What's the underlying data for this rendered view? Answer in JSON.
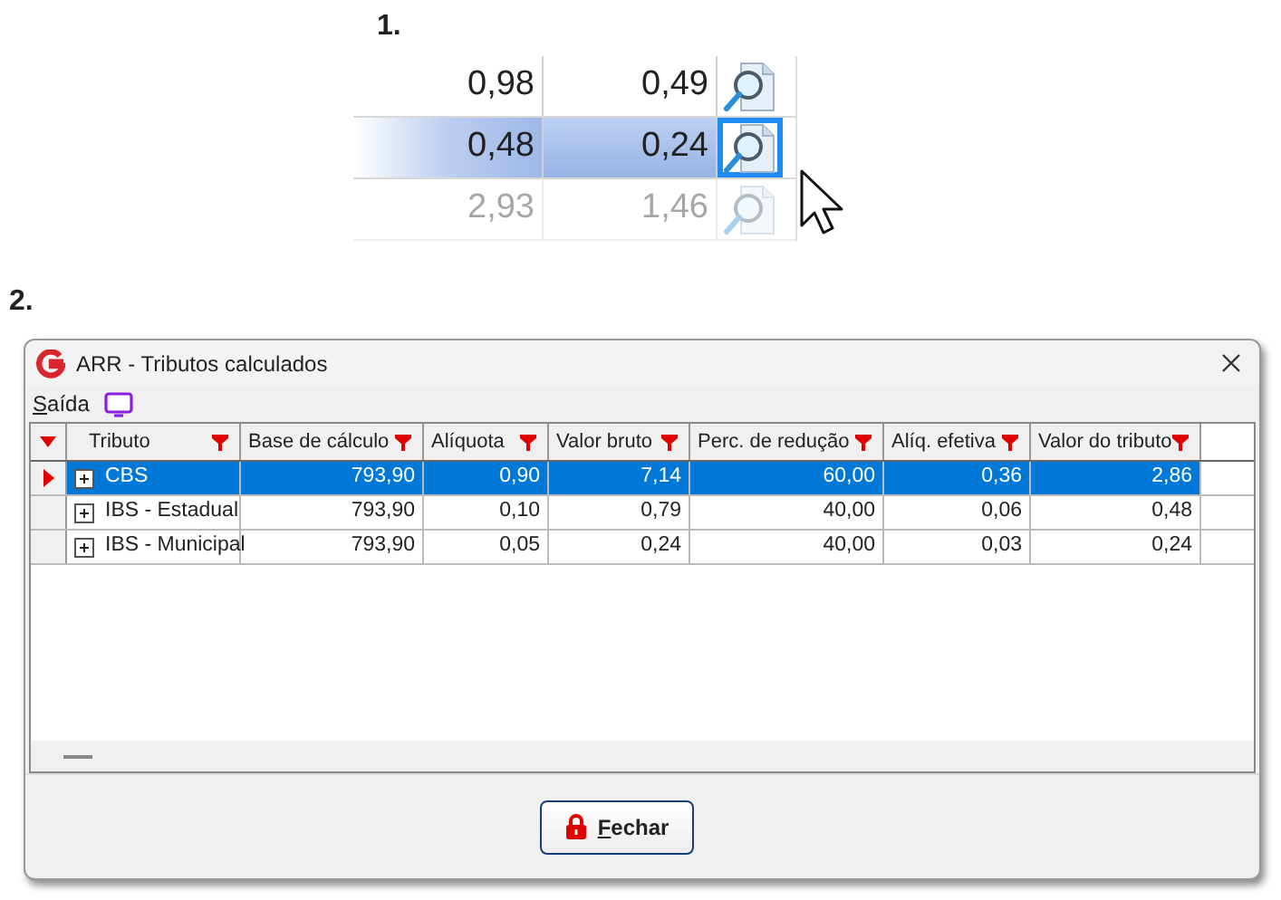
{
  "steps": [
    {
      "label": "1.",
      "kind": "snippet"
    },
    {
      "label": "2.",
      "kind": "window"
    }
  ],
  "snippet": {
    "rows": [
      {
        "values": [
          "0,98",
          "0,49"
        ],
        "selected": false,
        "faded": false
      },
      {
        "values": [
          "0,48",
          "0,24"
        ],
        "selected": true,
        "faded": false
      },
      {
        "values": [
          "2,93",
          "1,46"
        ],
        "selected": false,
        "faded": true
      }
    ]
  },
  "window": {
    "title": "ARR - Tributos calculados",
    "menu": [
      {
        "label": "Saída"
      }
    ],
    "table": {
      "columns": [
        "Tributo",
        "Base de cálculo",
        "Alíquota",
        "Valor bruto",
        "Perc. de redução",
        "Alíq. efetiva",
        "Valor do tributo"
      ],
      "rows": [
        {
          "cells": [
            "CBS",
            "793,90",
            "0,90",
            "7,14",
            "60,00",
            "0,36",
            "2,86"
          ],
          "selected": true
        },
        {
          "cells": [
            "IBS - Estadual",
            "793,90",
            "0,10",
            "0,79",
            "40,00",
            "0,06",
            "0,48"
          ],
          "selected": false
        },
        {
          "cells": [
            "IBS - Municipal",
            "793,90",
            "0,05",
            "0,24",
            "40,00",
            "0,03",
            "0,24"
          ],
          "selected": false
        }
      ]
    },
    "buttons": [
      {
        "label": "Fechar"
      }
    ]
  }
}
